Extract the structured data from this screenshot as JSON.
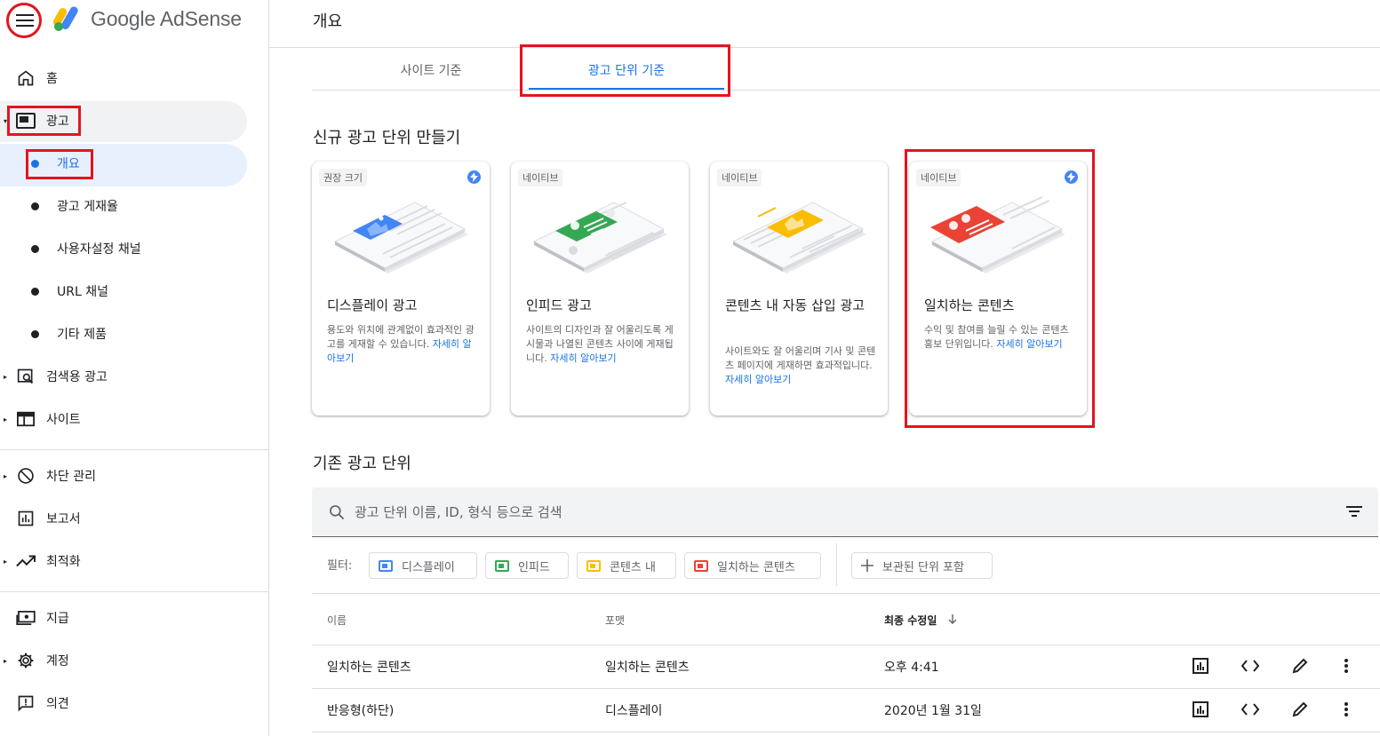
{
  "brand": {
    "name": "Google AdSense"
  },
  "header": {
    "title": "개요"
  },
  "sidebar": {
    "items": [
      {
        "label": "홈",
        "icon": "home-icon"
      },
      {
        "label": "광고",
        "icon": "ads-icon"
      },
      {
        "label": "검색용 광고",
        "icon": "search-ads-icon"
      },
      {
        "label": "사이트",
        "icon": "sites-icon"
      },
      {
        "label": "차단 관리",
        "icon": "block-icon"
      },
      {
        "label": "보고서",
        "icon": "reports-icon"
      },
      {
        "label": "최적화",
        "icon": "optimization-icon"
      },
      {
        "label": "지급",
        "icon": "payments-icon"
      },
      {
        "label": "계정",
        "icon": "settings-icon"
      },
      {
        "label": "의견",
        "icon": "feedback-icon"
      }
    ],
    "ads_sub": [
      "개요",
      "광고 게재율",
      "사용자설정 채널",
      "URL 채널",
      "기타 제품"
    ]
  },
  "tabs": [
    {
      "label": "사이트 기준",
      "active": false
    },
    {
      "label": "광고 단위 기준",
      "active": true
    }
  ],
  "new_units": {
    "title": "신규 광고 단위 만들기",
    "cards": [
      {
        "badge": "권장 크기",
        "title": "디스플레이 광고",
        "desc": "용도와 위치에 관계없이 효과적인 광고를 게재할 수 있습니다.",
        "link": "자세히 알아보기",
        "bolt": true
      },
      {
        "badge": "네이티브",
        "title": "인피드 광고",
        "desc": "사이트의 디자인과 잘 어울리도록 게시물과 나열된 콘텐츠 사이에 게재됩니다.",
        "link": "자세히 알아보기",
        "bolt": false
      },
      {
        "badge": "네이티브",
        "title": "콘텐츠 내 자동 삽입 광고",
        "desc": "사이트와도 잘 어울리며 기사 및 콘텐츠 페이지에 게재하면 효과적입니다.",
        "link": "자세히 알아보기",
        "bolt": false
      },
      {
        "badge": "네이티브",
        "title": "일치하는 콘텐츠",
        "desc": "수익 및 참여를 늘릴 수 있는 콘텐츠 홍보 단위입니다.",
        "link": "자세히 알아보기",
        "bolt": true
      }
    ]
  },
  "existing": {
    "title": "기존 광고 단위",
    "search_placeholder": "광고 단위 이름, ID, 형식 등으로 검색",
    "filter_label": "필터:",
    "chips": [
      "디스플레이",
      "인피드",
      "콘텐츠 내",
      "일치하는 콘텐츠"
    ],
    "archived_chip": "보관된 단위 포함",
    "columns": [
      "이름",
      "포맷",
      "최종 수정일"
    ],
    "rows": [
      {
        "name": "일치하는 콘텐츠",
        "format": "일치하는 콘텐츠",
        "modified": "오후 4:41"
      },
      {
        "name": "반응형(하단)",
        "format": "디스플레이",
        "modified": "2020년 1월 31일"
      }
    ]
  },
  "colors": {
    "accent": "#1a73e8",
    "highlight": "#e3141f",
    "blue": "#4285f4",
    "green": "#34a853",
    "yellow": "#fbbc04",
    "red": "#ea4335"
  }
}
